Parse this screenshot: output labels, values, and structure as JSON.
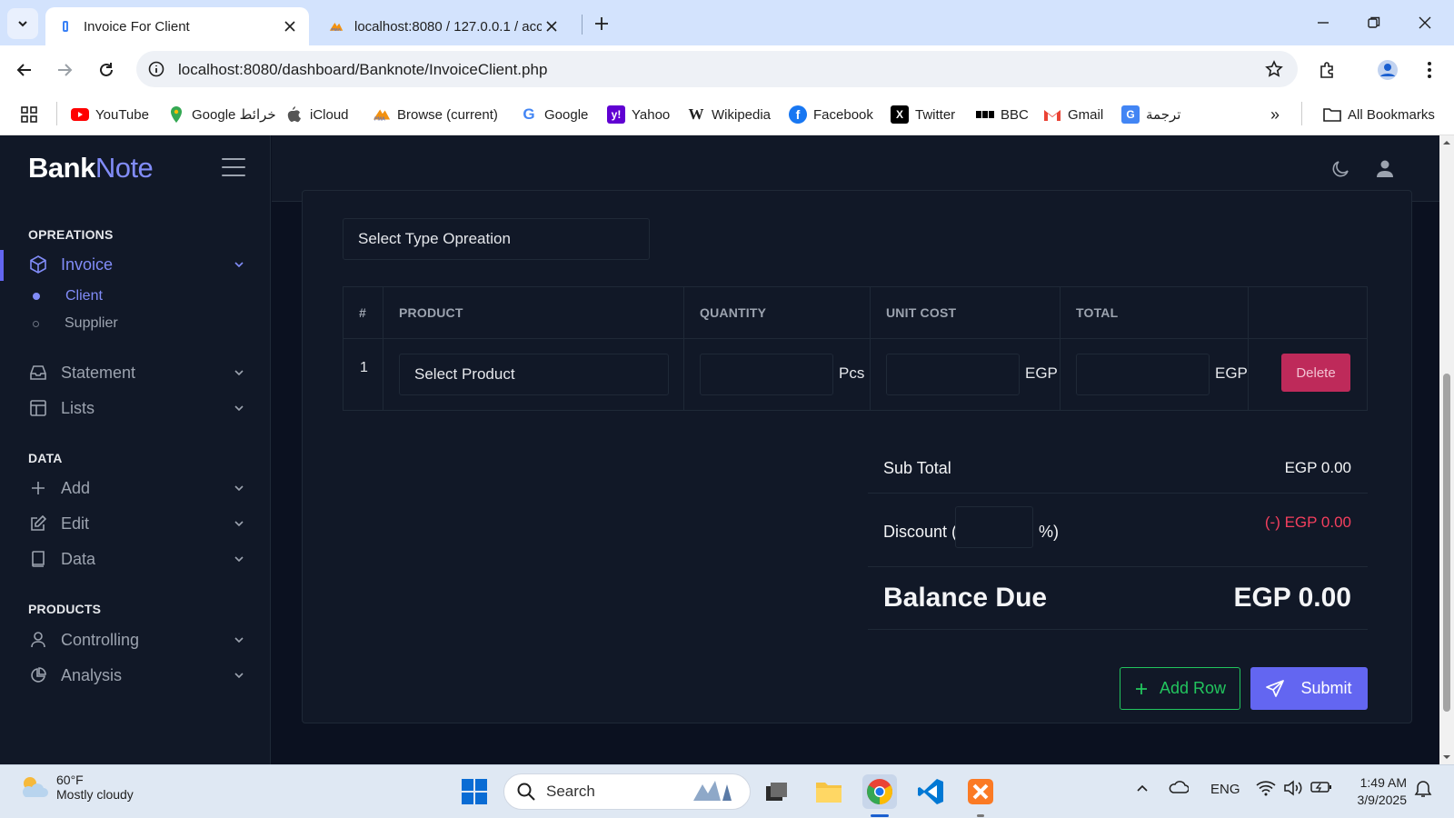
{
  "browser": {
    "tabs": [
      {
        "title": "Invoice For Client",
        "active": true
      },
      {
        "title": "localhost:8080 / 127.0.0.1 / acco",
        "active": false
      }
    ],
    "url": "localhost:8080/dashboard/Banknote/InvoiceClient.php",
    "bookmarks": [
      {
        "label": "YouTube",
        "icon": "youtube-icon"
      },
      {
        "label": "Google خرائط",
        "icon": "maps-icon"
      },
      {
        "label": "iCloud",
        "icon": "apple-icon"
      },
      {
        "label": "Browse (current)",
        "icon": "phpmyadmin-icon"
      },
      {
        "label": "Google",
        "icon": "google-icon"
      },
      {
        "label": "Yahoo",
        "icon": "yahoo-icon"
      },
      {
        "label": "Wikipedia",
        "icon": "wikipedia-icon"
      },
      {
        "label": "Facebook",
        "icon": "facebook-icon"
      },
      {
        "label": "Twitter",
        "icon": "x-icon"
      },
      {
        "label": "BBC",
        "icon": "bbc-icon"
      },
      {
        "label": "Gmail",
        "icon": "gmail-icon"
      },
      {
        "label": "ترجمة",
        "icon": "translate-icon"
      }
    ],
    "all_bookmarks": "All Bookmarks"
  },
  "app": {
    "brand_1": "Bank",
    "brand_2": "Note",
    "sidebar": {
      "sections": [
        {
          "heading": "OPREATIONS"
        },
        {
          "heading": "DATA"
        },
        {
          "heading": "PRODUCTS"
        }
      ],
      "items": {
        "invoice": "Invoice",
        "client": "Client",
        "supplier": "Supplier",
        "statement": "Statement",
        "lists": "Lists",
        "add": "Add",
        "edit": "Edit",
        "data": "Data",
        "controlling": "Controlling",
        "analysis": "Analysis"
      }
    },
    "form": {
      "select_type": "Select Type Opreation",
      "columns": [
        "#",
        "PRODUCT",
        "QUANTITY",
        "UNIT COST",
        "TOTAL"
      ],
      "row": {
        "num": "1",
        "product": "Select Product",
        "qty_unit": "Pcs",
        "cost_unit": "EGP",
        "total_unit": "EGP",
        "delete": "Delete"
      },
      "summary": {
        "subtotal_label": "Sub Total",
        "subtotal_value": "EGP 0.00",
        "discount_label_open": "Discount (",
        "discount_label_close": "%)",
        "discount_value": "(-) EGP 0.00",
        "balance_label": "Balance Due",
        "balance_value": "EGP 0.00"
      },
      "add_row": "Add Row",
      "submit": "Submit"
    }
  },
  "taskbar": {
    "temp": "60°F",
    "condition": "Mostly cloudy",
    "search": "Search",
    "lang": "ENG",
    "time": "1:49 AM",
    "date": "3/9/2025"
  },
  "colors": {
    "accent": "#6366f1",
    "accent_text": "#818cf8",
    "danger": "#be2a5a",
    "success": "#22c55e",
    "discount": "#f43f5e"
  }
}
